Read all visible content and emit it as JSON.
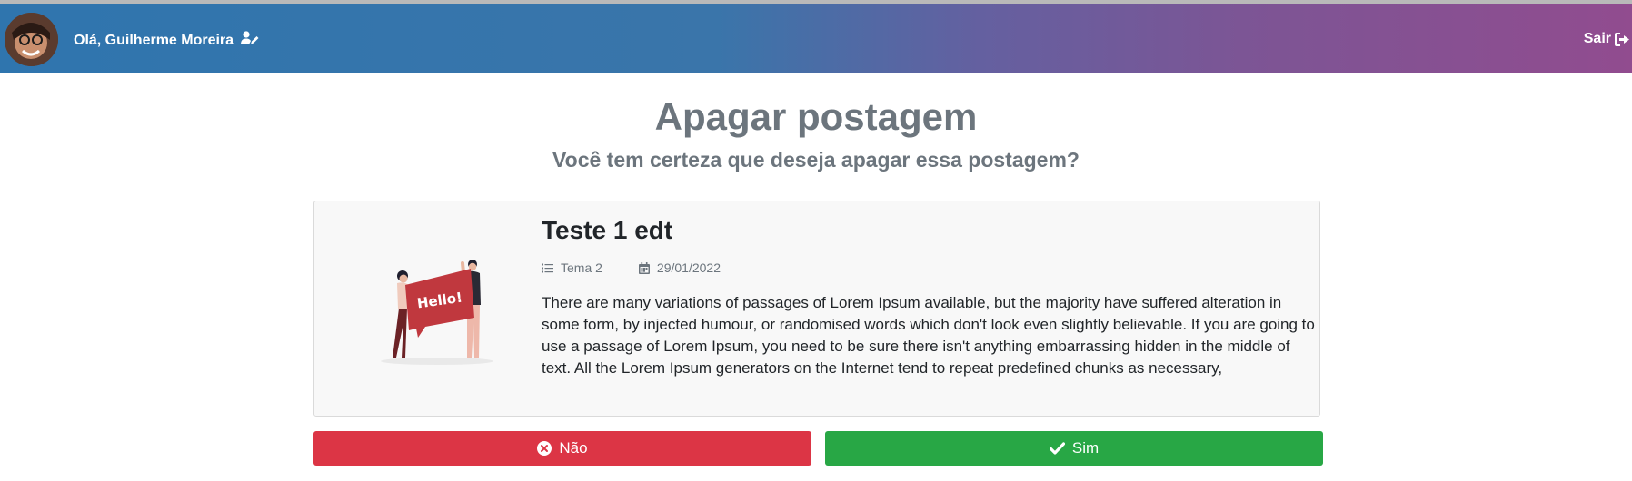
{
  "header": {
    "greeting": "Olá, Guilherme Moreira",
    "logout_label": "Sair"
  },
  "page": {
    "title": "Apagar postagem",
    "subtitle": "Você tem certeza que deseja apagar essa postagem?"
  },
  "post": {
    "title": "Teste 1 edt",
    "theme": "Tema 2",
    "date": "29/01/2022",
    "image_text": "Hello!",
    "body": "There are many variations of passages of Lorem Ipsum available, but the majority have suffered alteration in some form, by injected humour, or randomised words which don't look even slightly believable. If you are going to use a passage of Lorem Ipsum, you need to be sure there isn't anything embarrassing hidden in the middle of text. All the Lorem Ipsum generators on the Internet tend to repeat predefined chunks as necessary,"
  },
  "actions": {
    "no_label": "Não",
    "yes_label": "Sim"
  },
  "colors": {
    "danger": "#dc3545",
    "success": "#28a745",
    "muted": "#6c757d",
    "header_start": "#2f75ae",
    "header_end": "#914c8f"
  },
  "icons": {
    "user_edit": "user-edit-icon",
    "logout": "sign-out-icon",
    "theme": "list-icon",
    "date": "calendar-icon",
    "no": "times-circle-icon",
    "yes": "check-icon"
  }
}
